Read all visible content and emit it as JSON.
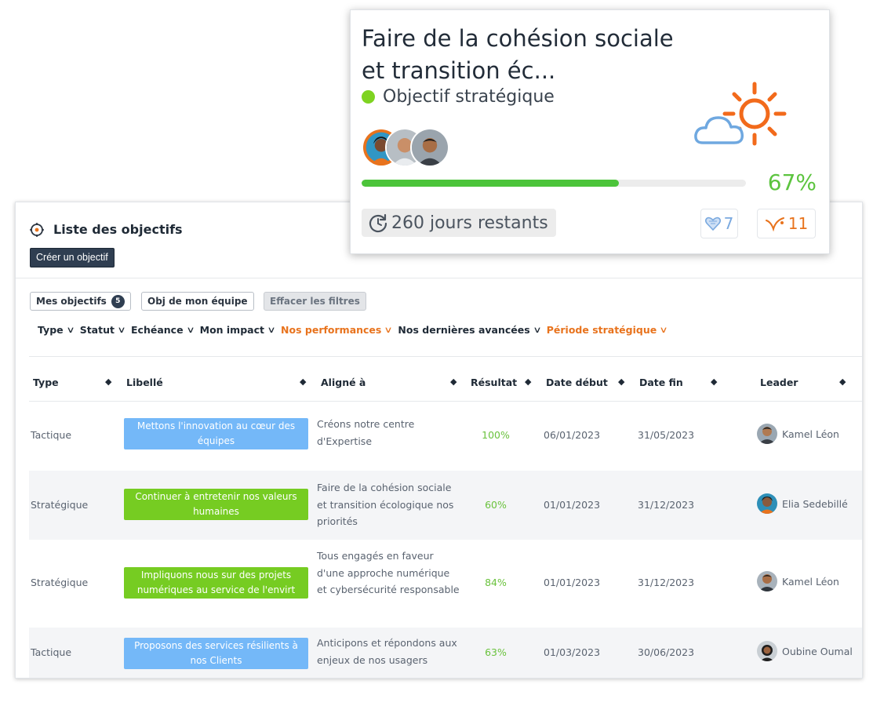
{
  "card": {
    "title": "Faire de la cohésion sociale et transition éc...",
    "type_label": "Objectif stratégique",
    "progress": 0.67,
    "progress_label": "67%",
    "days_remaining": "260 jours restants",
    "likes": "7",
    "signals": "11"
  },
  "list": {
    "title": "Liste des objectifs",
    "create_button": "Créer un objectif",
    "filters": {
      "mine": "Mes objectifs",
      "mine_count": "5",
      "team": "Obj de mon équipe",
      "clear": "Effacer les filtres"
    },
    "dropdowns": [
      {
        "label": "Type",
        "highlight": false
      },
      {
        "label": "Statut",
        "highlight": false
      },
      {
        "label": "Echéance",
        "highlight": false
      },
      {
        "label": "Mon impact",
        "highlight": false
      },
      {
        "label": "Nos performances",
        "highlight": true
      },
      {
        "label": "Nos dernières avancées",
        "highlight": false
      },
      {
        "label": "Période stratégique",
        "highlight": true
      }
    ],
    "columns": {
      "type": "Type",
      "label": "Libellé",
      "aligned": "Aligné à",
      "result": "Résultat",
      "start": "Date début",
      "end": "Date fin",
      "leader": "Leader"
    },
    "rows": [
      {
        "type": "Tactique",
        "label": "Mettons l'innovation au cœur des équipes",
        "color": "blue",
        "aligned": "Créons notre centre d'Expertise",
        "result": "100%",
        "start": "06/01/2023",
        "end": "31/05/2023",
        "leader": "Kamel Léon"
      },
      {
        "type": "Stratégique",
        "label": "Continuer à entretenir nos valeurs humaines",
        "color": "green",
        "aligned": "Faire de la cohésion sociale et transition écologique nos priorités",
        "result": "60%",
        "start": "01/01/2023",
        "end": "31/12/2023",
        "leader": "Elia Sedebillé"
      },
      {
        "type": "Stratégique",
        "label": "Impliquons nous sur des projets numériques au service de l'envirt",
        "color": "green",
        "aligned": "Tous engagés en faveur d'une approche numérique et cybersécurité responsable",
        "result": "84%",
        "start": "01/01/2023",
        "end": "31/12/2023",
        "leader": "Kamel Léon"
      },
      {
        "type": "Tactique",
        "label": "Proposons des services résilients à nos Clients",
        "color": "blue",
        "aligned": "Anticipons et répondons aux enjeux de nos usagers",
        "result": "63%",
        "start": "01/03/2023",
        "end": "30/06/2023",
        "leader": "Oubine Oumal"
      }
    ]
  },
  "colors": {
    "accent_orange": "#e8731d",
    "green": "#76cc22",
    "blue": "#74b8f8",
    "dark": "#2f3e51"
  }
}
